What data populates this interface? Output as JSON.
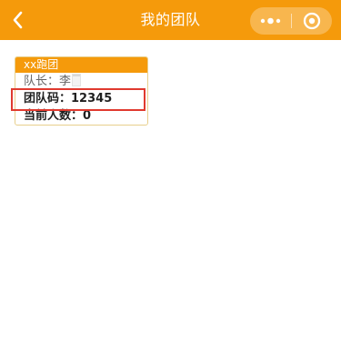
{
  "navbar": {
    "title": "我的团队",
    "back_icon": "back-chevron-icon",
    "more_icon": "more-dots-icon",
    "close_icon": "target-close-icon",
    "background": "#f59a0b"
  },
  "team_card": {
    "name": "xx跑团",
    "leader_label": "队长：",
    "leader_name": "李",
    "team_code_label": "团队码：",
    "team_code_value": "12345",
    "member_count_label": "当前人数：",
    "member_count_value": "0"
  },
  "highlight": {
    "target": "team-code",
    "color": "#e03a2f"
  }
}
